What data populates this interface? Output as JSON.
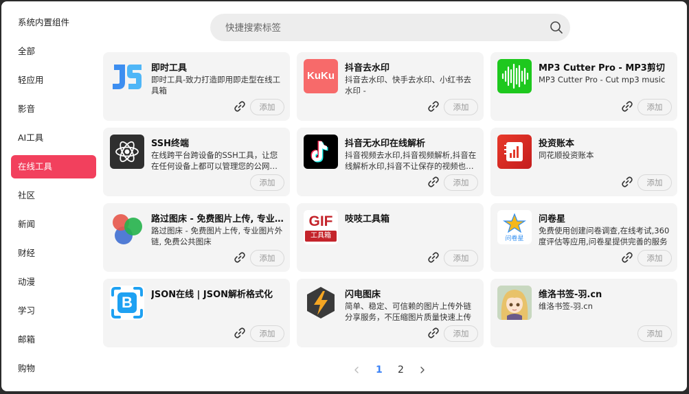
{
  "sidebar": {
    "items": [
      {
        "label": "系统内置组件"
      },
      {
        "label": "全部"
      },
      {
        "label": "轻应用"
      },
      {
        "label": "影音"
      },
      {
        "label": "AI工具"
      },
      {
        "label": "在线工具"
      },
      {
        "label": "社区"
      },
      {
        "label": "新闻"
      },
      {
        "label": "财经"
      },
      {
        "label": "动漫"
      },
      {
        "label": "学习"
      },
      {
        "label": "邮箱"
      },
      {
        "label": "购物"
      }
    ],
    "active_label": "在线工具",
    "active_color": "#f2405d"
  },
  "search": {
    "placeholder": "快捷搜索标签",
    "icon": "search-icon"
  },
  "add_label": "添加",
  "cards": [
    {
      "title": "即时工具",
      "desc": "即时工具-致力打造即用即走型在线工具箱",
      "icon": "js-logo-icon",
      "has_link": true
    },
    {
      "title": "抖音去水印",
      "desc": "抖音去水印、快手去水印、小红书去水印 -",
      "icon": "kuku-logo-icon",
      "logo_text": "KuKu",
      "has_link": true
    },
    {
      "title": "MP3 Cutter Pro - MP3剪切",
      "desc": "MP3 Cutter Pro - Cut mp3 music",
      "icon": "waveform-logo-icon",
      "has_link": true
    },
    {
      "title": "SSH终端",
      "desc": "在线跨平台跨设备的SSH工具，让您在任何设备上都可以管理您的公网服务器",
      "icon": "atom-logo-icon",
      "has_link": false
    },
    {
      "title": "抖音无水印在线解析",
      "desc": "抖音视频去水印,抖音视频解析,抖音在线解析水印,抖音不让保存的视频也能下载",
      "icon": "tiktok-logo-icon",
      "has_link": true
    },
    {
      "title": "投资账本",
      "desc": "同花顺投资账本",
      "icon": "ledger-logo-icon",
      "has_link": true
    },
    {
      "title": "路过图床 - 免费图片上传, 专业图片外链",
      "desc": "路过图床 - 免费图片上传, 专业图片外链, 免费公共图床",
      "icon": "circles-logo-icon",
      "has_link": true
    },
    {
      "title": "吱吱工具箱",
      "desc": "",
      "icon": "gif-logo-icon",
      "logo_text": "GIF",
      "logo_subtext": "工具箱",
      "has_link": true
    },
    {
      "title": "问卷星",
      "desc": "免费使用创建问卷调查,在线考试,360度评估等应用,问卷星提供完善的服务",
      "icon": "star-logo-icon",
      "logo_text": "问卷星",
      "has_link": true
    },
    {
      "title": "JSON在线 | JSON解析格式化",
      "desc": "",
      "icon": "json-b-logo-icon",
      "logo_text": "B",
      "has_link": true
    },
    {
      "title": "闪电图床",
      "desc": "简单、稳定、可信赖的图片上传外链分享服务，不压缩图片质量快速上传",
      "icon": "lightning-logo-icon",
      "has_link": true
    },
    {
      "title": "维洛书签-羽.cn",
      "desc": "维洛书签-羽.cn",
      "icon": "anime-avatar-logo-icon",
      "has_link": false
    }
  ],
  "pagination": {
    "prev_icon": "chevron-left-icon",
    "pages": [
      "1",
      "2"
    ],
    "current": "1",
    "next_icon": "chevron-right-icon",
    "current_color": "#3b82f6"
  }
}
